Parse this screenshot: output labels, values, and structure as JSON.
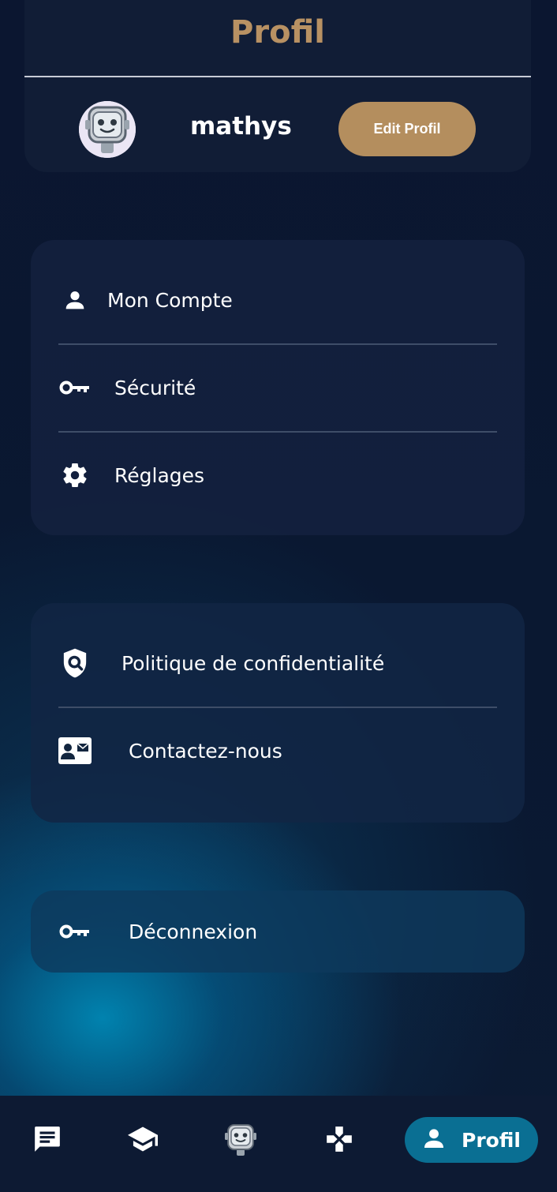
{
  "header": {
    "title": "Profil",
    "username": "mathys",
    "edit_button": "Edit Profil"
  },
  "account_menu": [
    {
      "label": "Mon Compte",
      "icon": "person-icon"
    },
    {
      "label": "Sécurité",
      "icon": "key-icon"
    },
    {
      "label": "Réglages",
      "icon": "gear-icon"
    }
  ],
  "info_menu": [
    {
      "label": "Politique de confidentialité",
      "icon": "privacy-shield-icon"
    },
    {
      "label": "Contactez-nous",
      "icon": "contact-card-icon"
    }
  ],
  "logout": {
    "label": "Déconnexion",
    "icon": "key-icon"
  },
  "bottom_nav": {
    "items": [
      {
        "icon": "chat-icon"
      },
      {
        "icon": "school-icon"
      },
      {
        "icon": "robot-icon"
      },
      {
        "icon": "gamepad-icon"
      },
      {
        "icon": "person-icon",
        "label": "Profil",
        "active": true
      }
    ]
  },
  "colors": {
    "accent": "#b48e5e",
    "title": "#b89163",
    "active_tab": "#0a6f93",
    "background": "#0b1630"
  }
}
